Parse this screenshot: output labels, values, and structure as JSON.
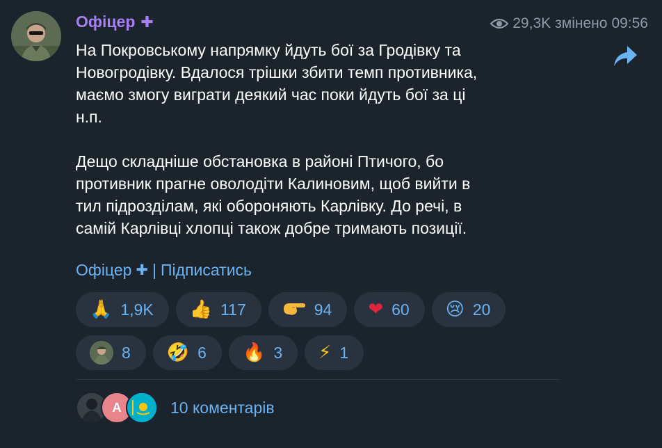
{
  "channel": {
    "name": "Офіцер",
    "views": "29,3K",
    "edited": "змінено",
    "time": "09:56"
  },
  "post": {
    "text": "На Покровському напрямку йдуть бої за Гродівку та\nНовогродівку. Вдалося трішки збити темп противника,\nмаємо змогу виграти деякий час поки йдуть бої за ці\nн.п.\n\nДещо складніше обстановка в районі Птичого, бо\nпротивник прагне оволодіти Калиновим, щоб вийти в\nтил підрозділам, які обороняють Карлівку. До речі, в\nсамій Карлівці хлопці також добре тримають позиції."
  },
  "signature": {
    "name": "Офіцер",
    "separator": "|",
    "subscribe": "Підписатись"
  },
  "reactions": {
    "row1": [
      {
        "icon": "pray-emoji",
        "glyph": "🙏",
        "count": "1,9K"
      },
      {
        "icon": "thumbs-up-emoji",
        "glyph": "👍",
        "count": "117"
      },
      {
        "icon": "pointing-hand-emoji",
        "glyph": "🫴",
        "count": "94"
      },
      {
        "icon": "heart-emoji",
        "glyph": "❤",
        "count": "60"
      },
      {
        "icon": "crying-face-emoji",
        "glyph": "😢",
        "count": "20"
      }
    ],
    "row2": [
      {
        "icon": "custom-avatar-emoji",
        "glyph": "",
        "count": "8"
      },
      {
        "icon": "rofl-emoji",
        "glyph": "🤣",
        "count": "6"
      },
      {
        "icon": "fire-emoji",
        "glyph": "🔥",
        "count": "3"
      },
      {
        "icon": "lightning-emoji",
        "glyph": "⚡",
        "count": "1"
      }
    ]
  },
  "comments": {
    "avatar_letter": "A",
    "label": "10 коментарів"
  },
  "colors": {
    "background": "#1b232d",
    "accent": "#6ab3f3",
    "name": "#a77ff2",
    "chip": "#29323f"
  }
}
